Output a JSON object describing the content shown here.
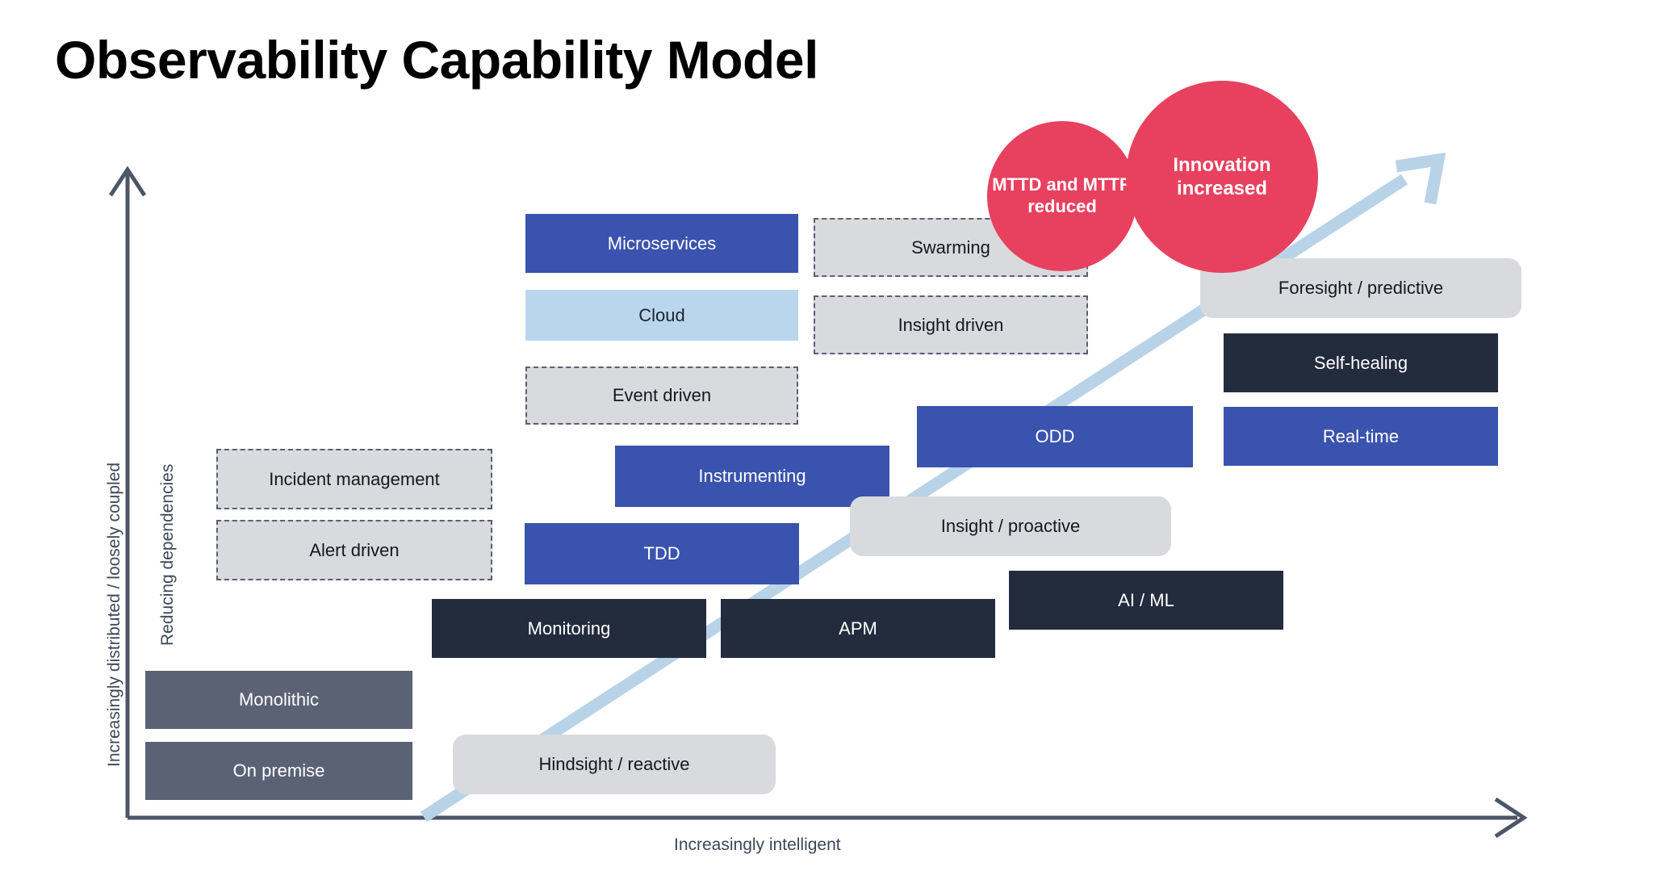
{
  "page_title": "Observability Capability Model",
  "axes": {
    "y_label_outer": "Increasingly distributed / loosely coupled",
    "y_label_inner": "Reducing dependencies",
    "x_label": "Increasingly intelligent",
    "axis_color": "#4c5667"
  },
  "trend_arrow": {
    "name": "maturity-trend-arrow",
    "color": "#b8d3e8"
  },
  "colors": {
    "blue": "#3a53ae",
    "light_blue": "#bad6ec",
    "dark_navy": "#232c3d",
    "slate": "#5a6274",
    "gray_fill": "#d9dadd",
    "dash_border": "#59606e",
    "crimson": "#e8415f",
    "axis": "#4c5667",
    "arrow": "#b8d3e8"
  },
  "circles": [
    {
      "id": "mttd",
      "label": "MTTD and MTTR reduced",
      "color": "#e8415f"
    },
    {
      "id": "innovation",
      "label": "Innovation increased",
      "color": "#e8415f"
    }
  ],
  "nodes": [
    {
      "id": "microservices",
      "label": "Microservices",
      "style": "blue"
    },
    {
      "id": "cloud",
      "label": "Cloud",
      "style": "light_blue"
    },
    {
      "id": "event-driven",
      "label": "Event driven",
      "style": "dashed"
    },
    {
      "id": "swarming",
      "label": "Swarming",
      "style": "dashed"
    },
    {
      "id": "insight-driven",
      "label": "Insight driven",
      "style": "dashed"
    },
    {
      "id": "incident-management",
      "label": "Incident management",
      "style": "dashed"
    },
    {
      "id": "alert-driven",
      "label": "Alert driven",
      "style": "dashed"
    },
    {
      "id": "instrumenting",
      "label": "Instrumenting",
      "style": "blue"
    },
    {
      "id": "tdd",
      "label": "TDD",
      "style": "blue"
    },
    {
      "id": "odd",
      "label": "ODD",
      "style": "blue"
    },
    {
      "id": "monitoring",
      "label": "Monitoring",
      "style": "dark"
    },
    {
      "id": "apm",
      "label": "APM",
      "style": "dark"
    },
    {
      "id": "ai-ml",
      "label": "AI / ML",
      "style": "dark"
    },
    {
      "id": "self-healing",
      "label": "Self-healing",
      "style": "dark"
    },
    {
      "id": "real-time",
      "label": "Real-time",
      "style": "blue"
    },
    {
      "id": "monolithic",
      "label": "Monolithic",
      "style": "slate"
    },
    {
      "id": "on-premise",
      "label": "On premise",
      "style": "slate"
    },
    {
      "id": "hindsight-reactive",
      "label": "Hindsight / reactive",
      "style": "pill"
    },
    {
      "id": "insight-proactive",
      "label": "Insight / proactive",
      "style": "pill"
    },
    {
      "id": "foresight-predictive",
      "label": "Foresight / predictive",
      "style": "pill"
    }
  ]
}
